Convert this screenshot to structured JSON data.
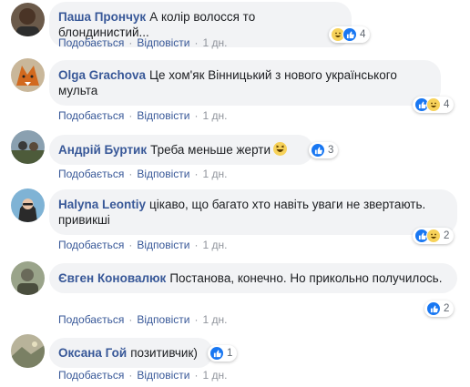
{
  "actions": {
    "like": "Подобається",
    "reply": "Відповісти",
    "sep": "·"
  },
  "comments": [
    {
      "author": "Паша Прончук",
      "text": "А колір волосся то блондинистий...",
      "time": "1 дн.",
      "reactions": [
        "haha",
        "like"
      ],
      "count": "4"
    },
    {
      "author": "Olga Grachova",
      "text": "Це хом'як Вінницький з нового українського мульта",
      "time": "1 дн.",
      "reactions": [
        "like",
        "haha"
      ],
      "count": "4"
    },
    {
      "author": "Андрій Буртик",
      "text": "Треба меньше жерти",
      "time": "1 дн.",
      "reactions": [
        "like"
      ],
      "count": "3",
      "inline_emoji": "laughing-emoji"
    },
    {
      "author": "Halyna Leontiy",
      "text": "цікаво, що багато хто навіть уваги не звертають. привикші",
      "time": "1 дн.",
      "reactions": [
        "like",
        "haha"
      ],
      "count": "2"
    },
    {
      "author": "Євген Коновалюк",
      "text": "Постанова, конечно. Но прикольно получилось.",
      "time": "1 дн.",
      "reactions": [
        "like"
      ],
      "count": "2"
    },
    {
      "author": "Оксана Гой",
      "text": "позитивчик)",
      "time": "1 дн.",
      "reactions": [
        "like"
      ],
      "count": "1"
    }
  ],
  "colors": {
    "author": "#385898",
    "bubble": "#f2f3f5",
    "like": "#1877f2",
    "haha": "#f7d25a"
  }
}
